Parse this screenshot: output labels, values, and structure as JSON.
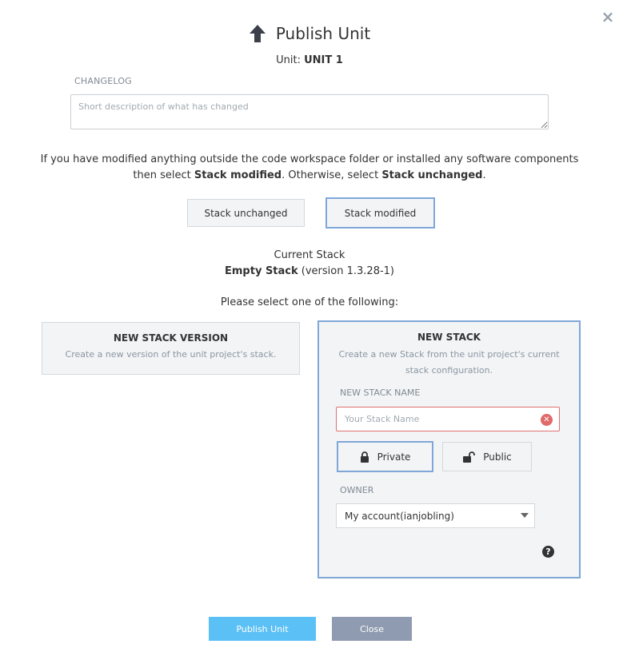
{
  "dialog": {
    "title": "Publish Unit",
    "close_symbol": "×",
    "unit_label": "Unit:",
    "unit_name": "UNIT 1"
  },
  "changelog": {
    "label": "CHANGELOG",
    "placeholder": "Short description of what has changed",
    "value": ""
  },
  "instructions": {
    "line1": "If you have modified anything outside the code workspace folder or installed any software components",
    "line2_prefix": "then select ",
    "option_modified": "Stack modified",
    "line2_middle": ". Otherwise, select ",
    "option_unchanged": "Stack unchanged",
    "line2_suffix": "."
  },
  "stack_choice": {
    "unchanged_label": "Stack unchanged",
    "modified_label": "Stack modified",
    "selected": "Stack modified"
  },
  "current_stack": {
    "heading": "Current Stack",
    "name": "Empty Stack",
    "version_text": "(version 1.3.28-1)"
  },
  "prompt": "Please select one of the following:",
  "new_stack_version": {
    "title": "NEW STACK VERSION",
    "description": "Create a new version of the unit project's stack."
  },
  "new_stack": {
    "title": "NEW STACK",
    "description_line1": "Create a new Stack from the unit project's current",
    "description_line2": "stack configuration.",
    "name_label": "NEW STACK NAME",
    "name_placeholder": "Your Stack Name",
    "name_value": "",
    "clear_symbol": "✕",
    "visibility": {
      "private_label": "Private",
      "public_label": "Public",
      "selected": "Private"
    },
    "owner_label": "OWNER",
    "owner_value": "My account(ianjobling)",
    "help_symbol": "?"
  },
  "footer": {
    "publish_label": "Publish Unit",
    "close_label": "Close"
  },
  "colors": {
    "accent_border": "#7fa7d8",
    "publish_bg": "#5bc0f5",
    "close_bg": "#8e9bb0",
    "error_border": "#e07070"
  },
  "icons": {
    "title": "arrow-up-icon",
    "dialog_close": "close-icon",
    "clear": "clear-icon",
    "private": "lock-icon",
    "public": "unlock-icon",
    "owner_caret": "caret-down-icon",
    "help": "help-icon"
  }
}
